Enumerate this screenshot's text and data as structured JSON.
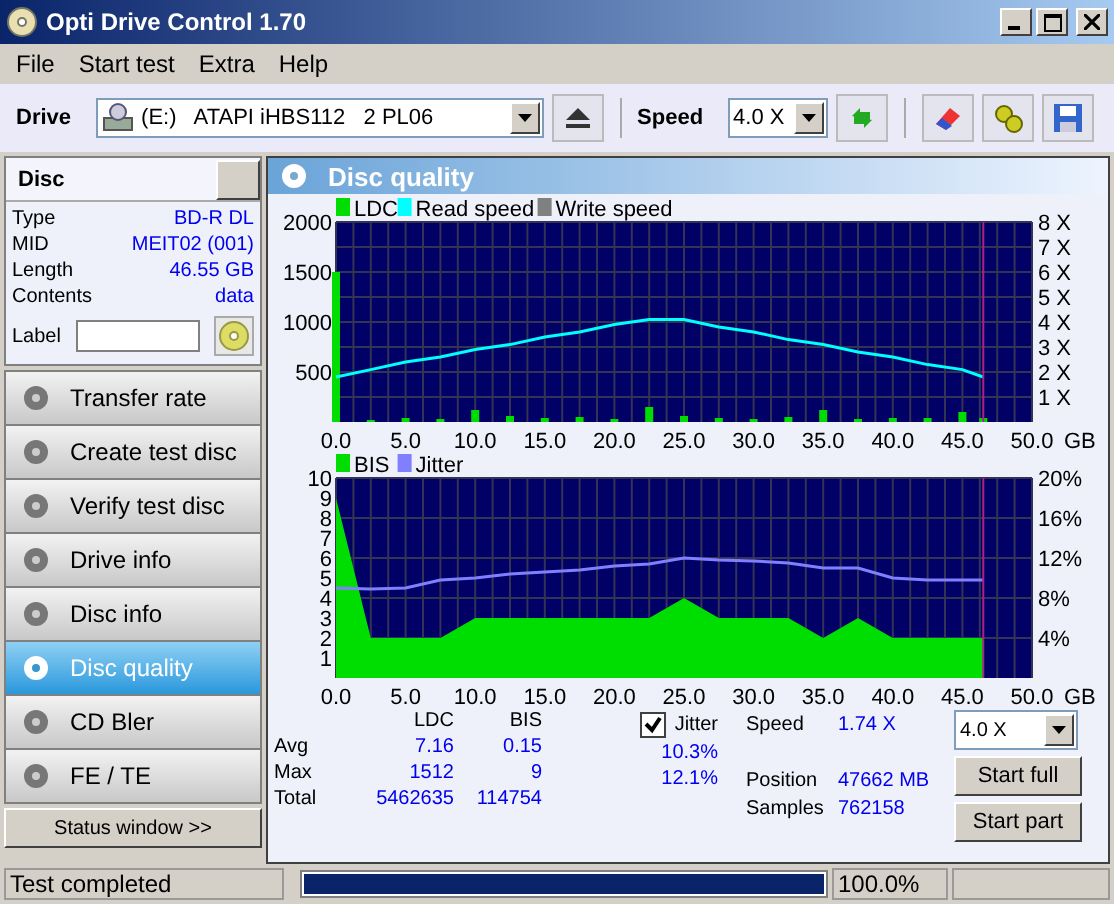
{
  "window": {
    "title": "Opti Drive Control 1.70"
  },
  "menu": [
    "File",
    "Start test",
    "Extra",
    "Help"
  ],
  "toolbar": {
    "drive_label": "Drive",
    "drive": "(E:)   ATAPI iHBS112   2 PL06",
    "speed_label": "Speed",
    "speed": "4.0 X"
  },
  "disc": {
    "title": "Disc",
    "fields": [
      {
        "label": "Type",
        "value": "BD-R DL"
      },
      {
        "label": "MID",
        "value": "MEIT02 (001)"
      },
      {
        "label": "Length",
        "value": "46.55 GB"
      },
      {
        "label": "Contents",
        "value": "data"
      }
    ],
    "label_field": "Label"
  },
  "nav": [
    {
      "label": "Transfer rate",
      "selected": false
    },
    {
      "label": "Create test disc",
      "selected": false
    },
    {
      "label": "Verify test disc",
      "selected": false
    },
    {
      "label": "Drive info",
      "selected": false
    },
    {
      "label": "Disc info",
      "selected": false
    },
    {
      "label": "Disc quality",
      "selected": true
    },
    {
      "label": "CD Bler",
      "selected": false
    },
    {
      "label": "FE / TE",
      "selected": false
    }
  ],
  "status_window_button": "Status window >>",
  "panel": {
    "title": "Disc quality",
    "charts": [
      {
        "chart_data": {
          "type": "line",
          "xlabel": "GB",
          "x": [
            0,
            2.5,
            5,
            7.5,
            10,
            12.5,
            15,
            17.5,
            20,
            22.5,
            25,
            27.5,
            30,
            32.5,
            35,
            37.5,
            40,
            42.5,
            45,
            46.5
          ],
          "xlim": [
            0,
            50
          ],
          "ylim": [
            0,
            2000
          ],
          "y2lim": [
            0,
            8
          ],
          "grid": true,
          "legend": true,
          "ref_lines": [
            {
              "axis": "x",
              "value": 46.5,
              "color": "#aa2288"
            }
          ],
          "xticks": [
            {
              "value": 0,
              "label": "0.0"
            },
            {
              "value": 5,
              "label": "5.0"
            },
            {
              "value": 10,
              "label": "10.0"
            },
            {
              "value": 15,
              "label": "15.0"
            },
            {
              "value": 20,
              "label": "20.0"
            },
            {
              "value": 25,
              "label": "25.0"
            },
            {
              "value": 30,
              "label": "30.0"
            },
            {
              "value": 35,
              "label": "35.0"
            },
            {
              "value": 40,
              "label": "40.0"
            },
            {
              "value": 45,
              "label": "45.0"
            },
            {
              "value": 50,
              "label": "50.0"
            }
          ],
          "yticks": [
            500,
            1000,
            1500,
            2000
          ],
          "y2ticks": [
            {
              "value": 1,
              "label": "1 X"
            },
            {
              "value": 2,
              "label": "2 X"
            },
            {
              "value": 3,
              "label": "3 X"
            },
            {
              "value": 4,
              "label": "4 X"
            },
            {
              "value": 5,
              "label": "5 X"
            },
            {
              "value": 6,
              "label": "6 X"
            },
            {
              "value": 7,
              "label": "7 X"
            },
            {
              "value": 8,
              "label": "8 X"
            }
          ],
          "series": [
            {
              "name": "LDC",
              "color": "#00dd00",
              "type": "bar",
              "values": [
                1500,
                20,
                40,
                30,
                120,
                60,
                40,
                50,
                30,
                150,
                60,
                40,
                30,
                50,
                120,
                30,
                40,
                40,
                100,
                40
              ]
            },
            {
              "name": "Read speed",
              "color": "#00ffff",
              "axis": "y2",
              "values": [
                1.8,
                2.1,
                2.4,
                2.6,
                2.9,
                3.1,
                3.4,
                3.6,
                3.9,
                4.1,
                4.1,
                3.8,
                3.6,
                3.3,
                3.1,
                2.8,
                2.6,
                2.3,
                2.1,
                1.8
              ]
            },
            {
              "name": "Write speed",
              "color": "#808080",
              "values": [
                null,
                null,
                null,
                null,
                null,
                null,
                null,
                null,
                null,
                null,
                null,
                null,
                null,
                null,
                null,
                null,
                null,
                null,
                null,
                null
              ]
            }
          ]
        }
      },
      {
        "chart_data": {
          "type": "line",
          "xlabel": "GB",
          "x": [
            0,
            2.5,
            5,
            7.5,
            10,
            12.5,
            15,
            17.5,
            20,
            22.5,
            25,
            27.5,
            30,
            32.5,
            35,
            37.5,
            40,
            42.5,
            45,
            46.5
          ],
          "xlim": [
            0,
            50
          ],
          "ylim": [
            0,
            10
          ],
          "y2lim": [
            0,
            20
          ],
          "grid": true,
          "legend": true,
          "ref_lines": [
            {
              "axis": "x",
              "value": 46.5,
              "color": "#aa2288"
            }
          ],
          "xticks": [
            {
              "value": 0,
              "label": "0.0"
            },
            {
              "value": 5,
              "label": "5.0"
            },
            {
              "value": 10,
              "label": "10.0"
            },
            {
              "value": 15,
              "label": "15.0"
            },
            {
              "value": 20,
              "label": "20.0"
            },
            {
              "value": 25,
              "label": "25.0"
            },
            {
              "value": 30,
              "label": "30.0"
            },
            {
              "value": 35,
              "label": "35.0"
            },
            {
              "value": 40,
              "label": "40.0"
            },
            {
              "value": 45,
              "label": "45.0"
            },
            {
              "value": 50,
              "label": "50.0"
            }
          ],
          "yticks": [
            1,
            2,
            3,
            4,
            5,
            6,
            7,
            8,
            9,
            10
          ],
          "y2ticks": [
            {
              "value": 4,
              "label": "4%"
            },
            {
              "value": 8,
              "label": "8%"
            },
            {
              "value": 12,
              "label": "12%"
            },
            {
              "value": 16,
              "label": "16%"
            },
            {
              "value": 20,
              "label": "20%"
            }
          ],
          "series": [
            {
              "name": "BIS",
              "color": "#00dd00",
              "type": "area",
              "values": [
                9,
                2,
                2,
                2,
                3,
                3,
                3,
                3,
                3,
                3,
                4,
                3,
                3,
                3,
                2,
                3,
                2,
                2,
                2,
                2
              ]
            },
            {
              "name": "Jitter",
              "color": "#8080ff",
              "axis": "y2",
              "values": [
                9.0,
                8.9,
                9.0,
                9.8,
                10.0,
                10.4,
                10.6,
                10.8,
                11.2,
                11.4,
                12.0,
                11.8,
                11.7,
                11.5,
                11.0,
                11.0,
                10.0,
                9.8,
                9.8,
                9.8
              ]
            }
          ]
        }
      }
    ]
  },
  "stats": {
    "columns": [
      "LDC",
      "BIS"
    ],
    "rows": [
      {
        "label": "Avg",
        "ldc": "7.16",
        "bis": "0.15",
        "jitter": "10.3%"
      },
      {
        "label": "Max",
        "ldc": "1512",
        "bis": "9",
        "jitter": "12.1%"
      },
      {
        "label": "Total",
        "ldc": "5462635",
        "bis": "114754"
      }
    ],
    "jitter_checkbox": {
      "label": "Jitter",
      "checked": true
    },
    "info": [
      {
        "label": "Speed",
        "value": "1.74 X"
      },
      {
        "label": "Position",
        "value": "47662 MB"
      },
      {
        "label": "Samples",
        "value": "762158"
      }
    ],
    "speed_select": "4.0 X",
    "buttons": [
      "Start full",
      "Start part"
    ]
  },
  "status_bar": {
    "text": "Test completed",
    "level": 1.0,
    "percent": "100.0%"
  }
}
